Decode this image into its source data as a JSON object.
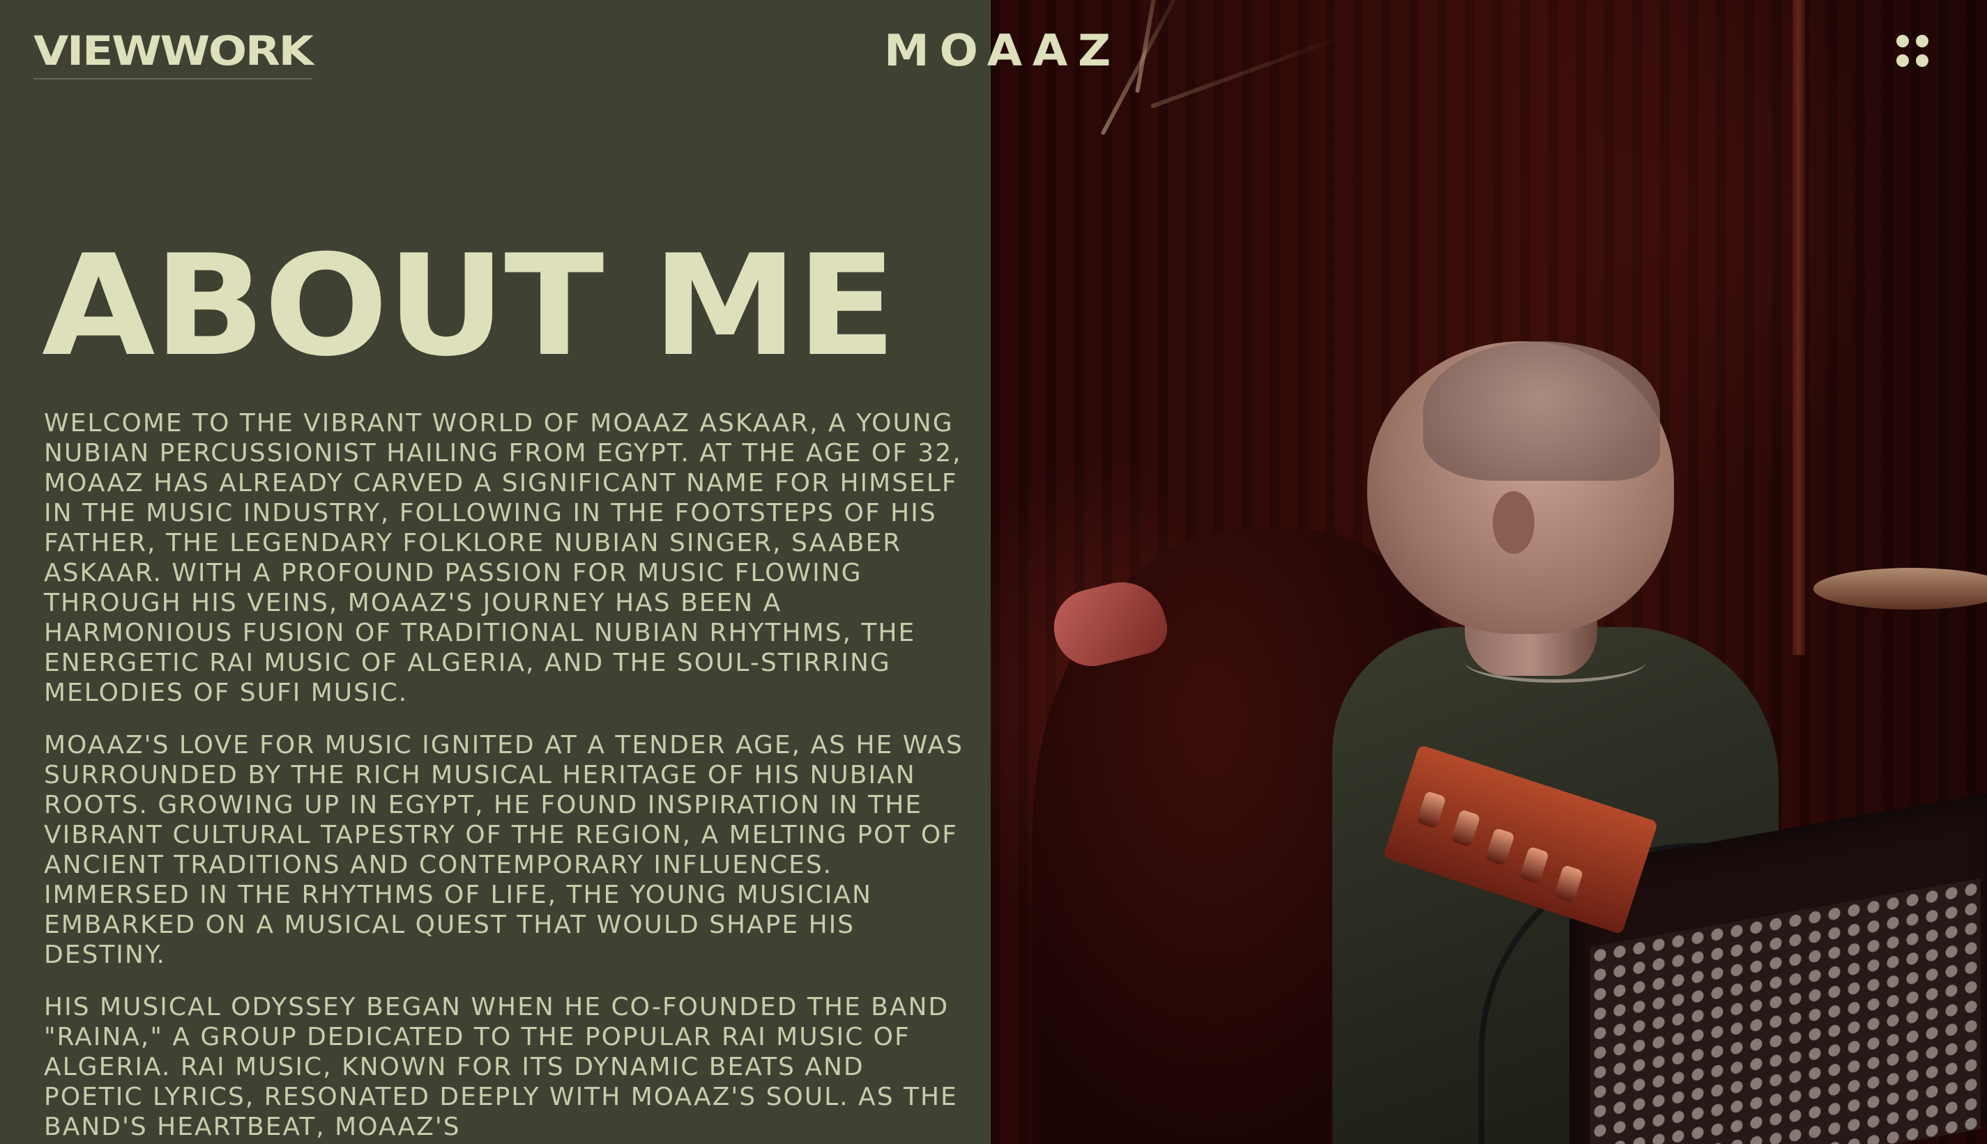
{
  "header": {
    "brand": "VIEWWORK",
    "site_title": "MOAAZ",
    "menu_icon": "grid-dots-icon"
  },
  "about": {
    "title": "ABOUT ME",
    "paragraphs": [
      "WELCOME TO THE VIBRANT WORLD OF MOAAZ ASKAAR, A YOUNG NUBIAN PERCUSSIONIST HAILING FROM EGYPT. AT THE AGE OF 32, MOAAZ HAS ALREADY CARVED A SIGNIFICANT NAME FOR HIMSELF IN THE MUSIC INDUSTRY, FOLLOWING IN THE FOOTSTEPS OF HIS FATHER, THE LEGENDARY FOLKLORE NUBIAN SINGER, SAABER ASKAAR. WITH A PROFOUND PASSION FOR MUSIC FLOWING THROUGH HIS VEINS, MOAAZ'S JOURNEY HAS BEEN A HARMONIOUS FUSION OF TRADITIONAL NUBIAN RHYTHMS, THE ENERGETIC RAI MUSIC OF ALGERIA, AND THE SOUL-STIRRING MELODIES OF SUFI MUSIC.",
      "MOAAZ'S LOVE FOR MUSIC IGNITED AT A TENDER AGE, AS HE WAS SURROUNDED BY THE RICH MUSICAL HERITAGE OF HIS NUBIAN ROOTS. GROWING UP IN EGYPT, HE FOUND INSPIRATION IN THE VIBRANT CULTURAL TAPESTRY OF THE REGION, A MELTING POT OF ANCIENT TRADITIONS AND CONTEMPORARY INFLUENCES. IMMERSED IN THE RHYTHMS OF LIFE, THE YOUNG MUSICIAN EMBARKED ON A MUSICAL QUEST THAT WOULD SHAPE HIS DESTINY.",
      "HIS MUSICAL ODYSSEY BEGAN WHEN HE CO-FOUNDED THE BAND \"RAINA,\" A GROUP DEDICATED TO THE POPULAR RAI MUSIC OF ALGERIA. RAI MUSIC, KNOWN FOR ITS DYNAMIC BEATS AND POETIC LYRICS, RESONATED DEEPLY WITH MOAAZ'S SOUL. AS THE BAND'S HEARTBEAT, MOAAZ'S"
    ]
  },
  "colors": {
    "panel_bg": "#3f4233",
    "heading": "#dde0bb",
    "body_text": "#c9cca9"
  }
}
